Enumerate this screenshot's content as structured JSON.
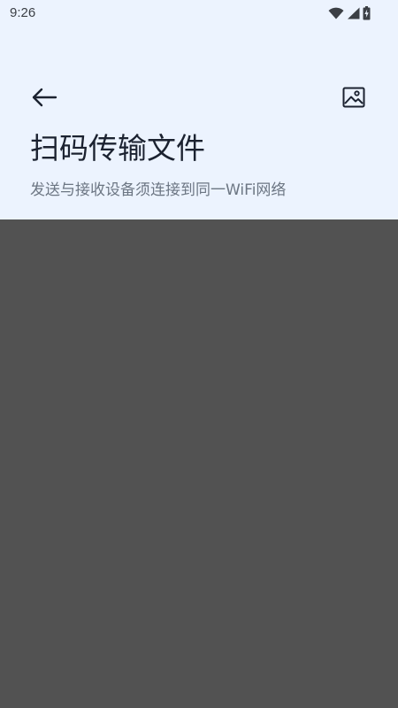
{
  "status_bar": {
    "time": "9:26",
    "icons": [
      "wifi-icon",
      "signal-icon",
      "battery-charging-icon"
    ]
  },
  "toolbar": {
    "back_icon": "arrow-left-icon",
    "gallery_icon": "image-icon"
  },
  "header": {
    "title": "扫码传输文件",
    "subtitle": "发送与接收设备须连接到同一WiFi网络"
  },
  "colors": {
    "header_bg": "#ECF3FE",
    "camera_bg": "#525252",
    "title": "#1B2230",
    "subtitle": "#6C7683"
  }
}
